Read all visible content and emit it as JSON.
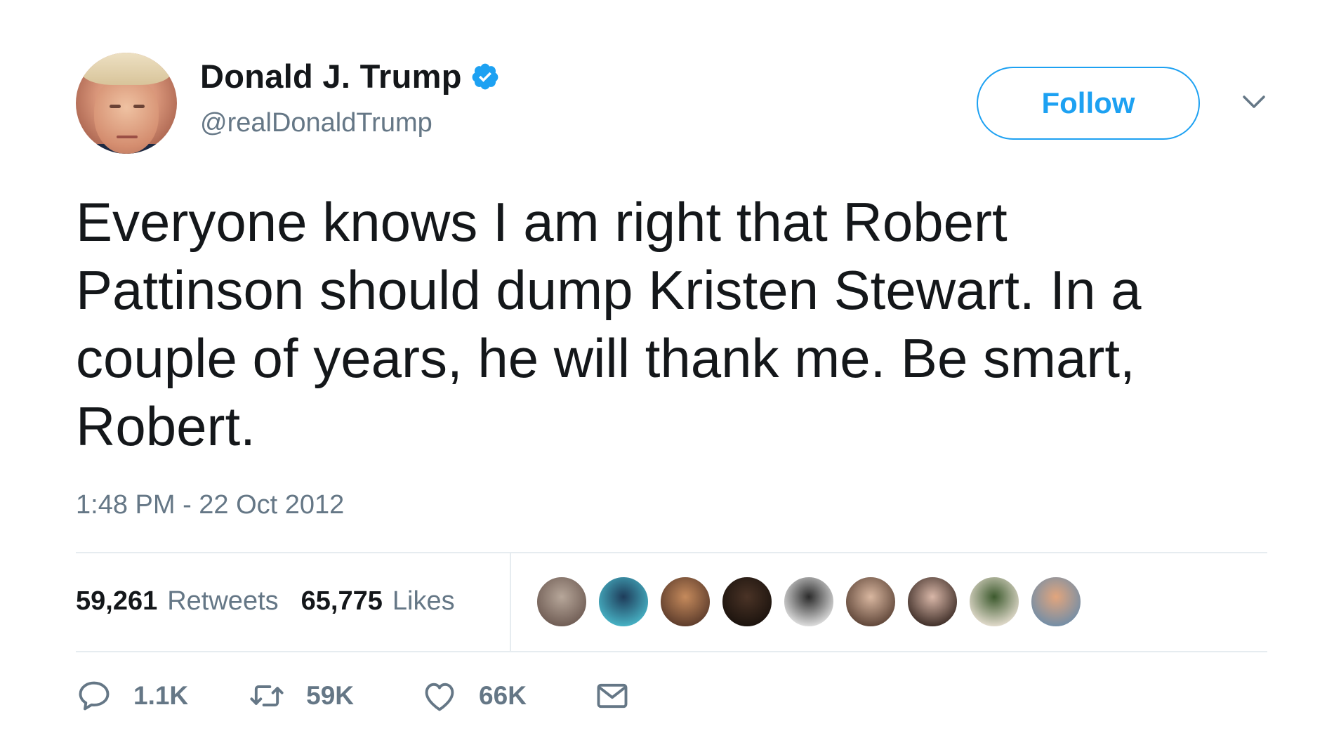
{
  "user": {
    "display_name": "Donald J. Trump",
    "handle": "@realDonaldTrump",
    "verified": true,
    "verified_color": "#1da1f2"
  },
  "follow_button": {
    "label": "Follow",
    "color": "#1da1f2"
  },
  "tweet": {
    "text": "Everyone knows I am right that Robert\nPattinson should dump Kristen Stewart. In a\ncouple of years, he will thank me. Be smart,\nRobert.",
    "timestamp": "1:48 PM - 22 Oct 2012"
  },
  "stats": {
    "retweets_count": "59,261",
    "retweets_label": "Retweets",
    "likes_count": "65,775",
    "likes_label": "Likes"
  },
  "liker_avatars": [
    {
      "colors": [
        "#b7a79a",
        "#6d5a52"
      ]
    },
    {
      "colors": [
        "#1e3c5a",
        "#49b7c9"
      ]
    },
    {
      "colors": [
        "#c58a5c",
        "#5a3a2a"
      ]
    },
    {
      "colors": [
        "#4a3326",
        "#1a120d"
      ]
    },
    {
      "colors": [
        "#2b2b2b",
        "#e5e5e5"
      ]
    },
    {
      "colors": [
        "#d9b7a0",
        "#5b4235"
      ]
    },
    {
      "colors": [
        "#d9b7a8",
        "#3a2a24"
      ]
    },
    {
      "colors": [
        "#3d5a2e",
        "#e8e0d2"
      ]
    },
    {
      "colors": [
        "#e2a57d",
        "#6f8da8"
      ]
    }
  ],
  "actions": {
    "reply_count": "1.1K",
    "retweet_count": "59K",
    "like_count": "66K"
  },
  "colors": {
    "text_primary": "#14171a",
    "text_secondary": "#657786",
    "divider": "#e6ecf0"
  }
}
